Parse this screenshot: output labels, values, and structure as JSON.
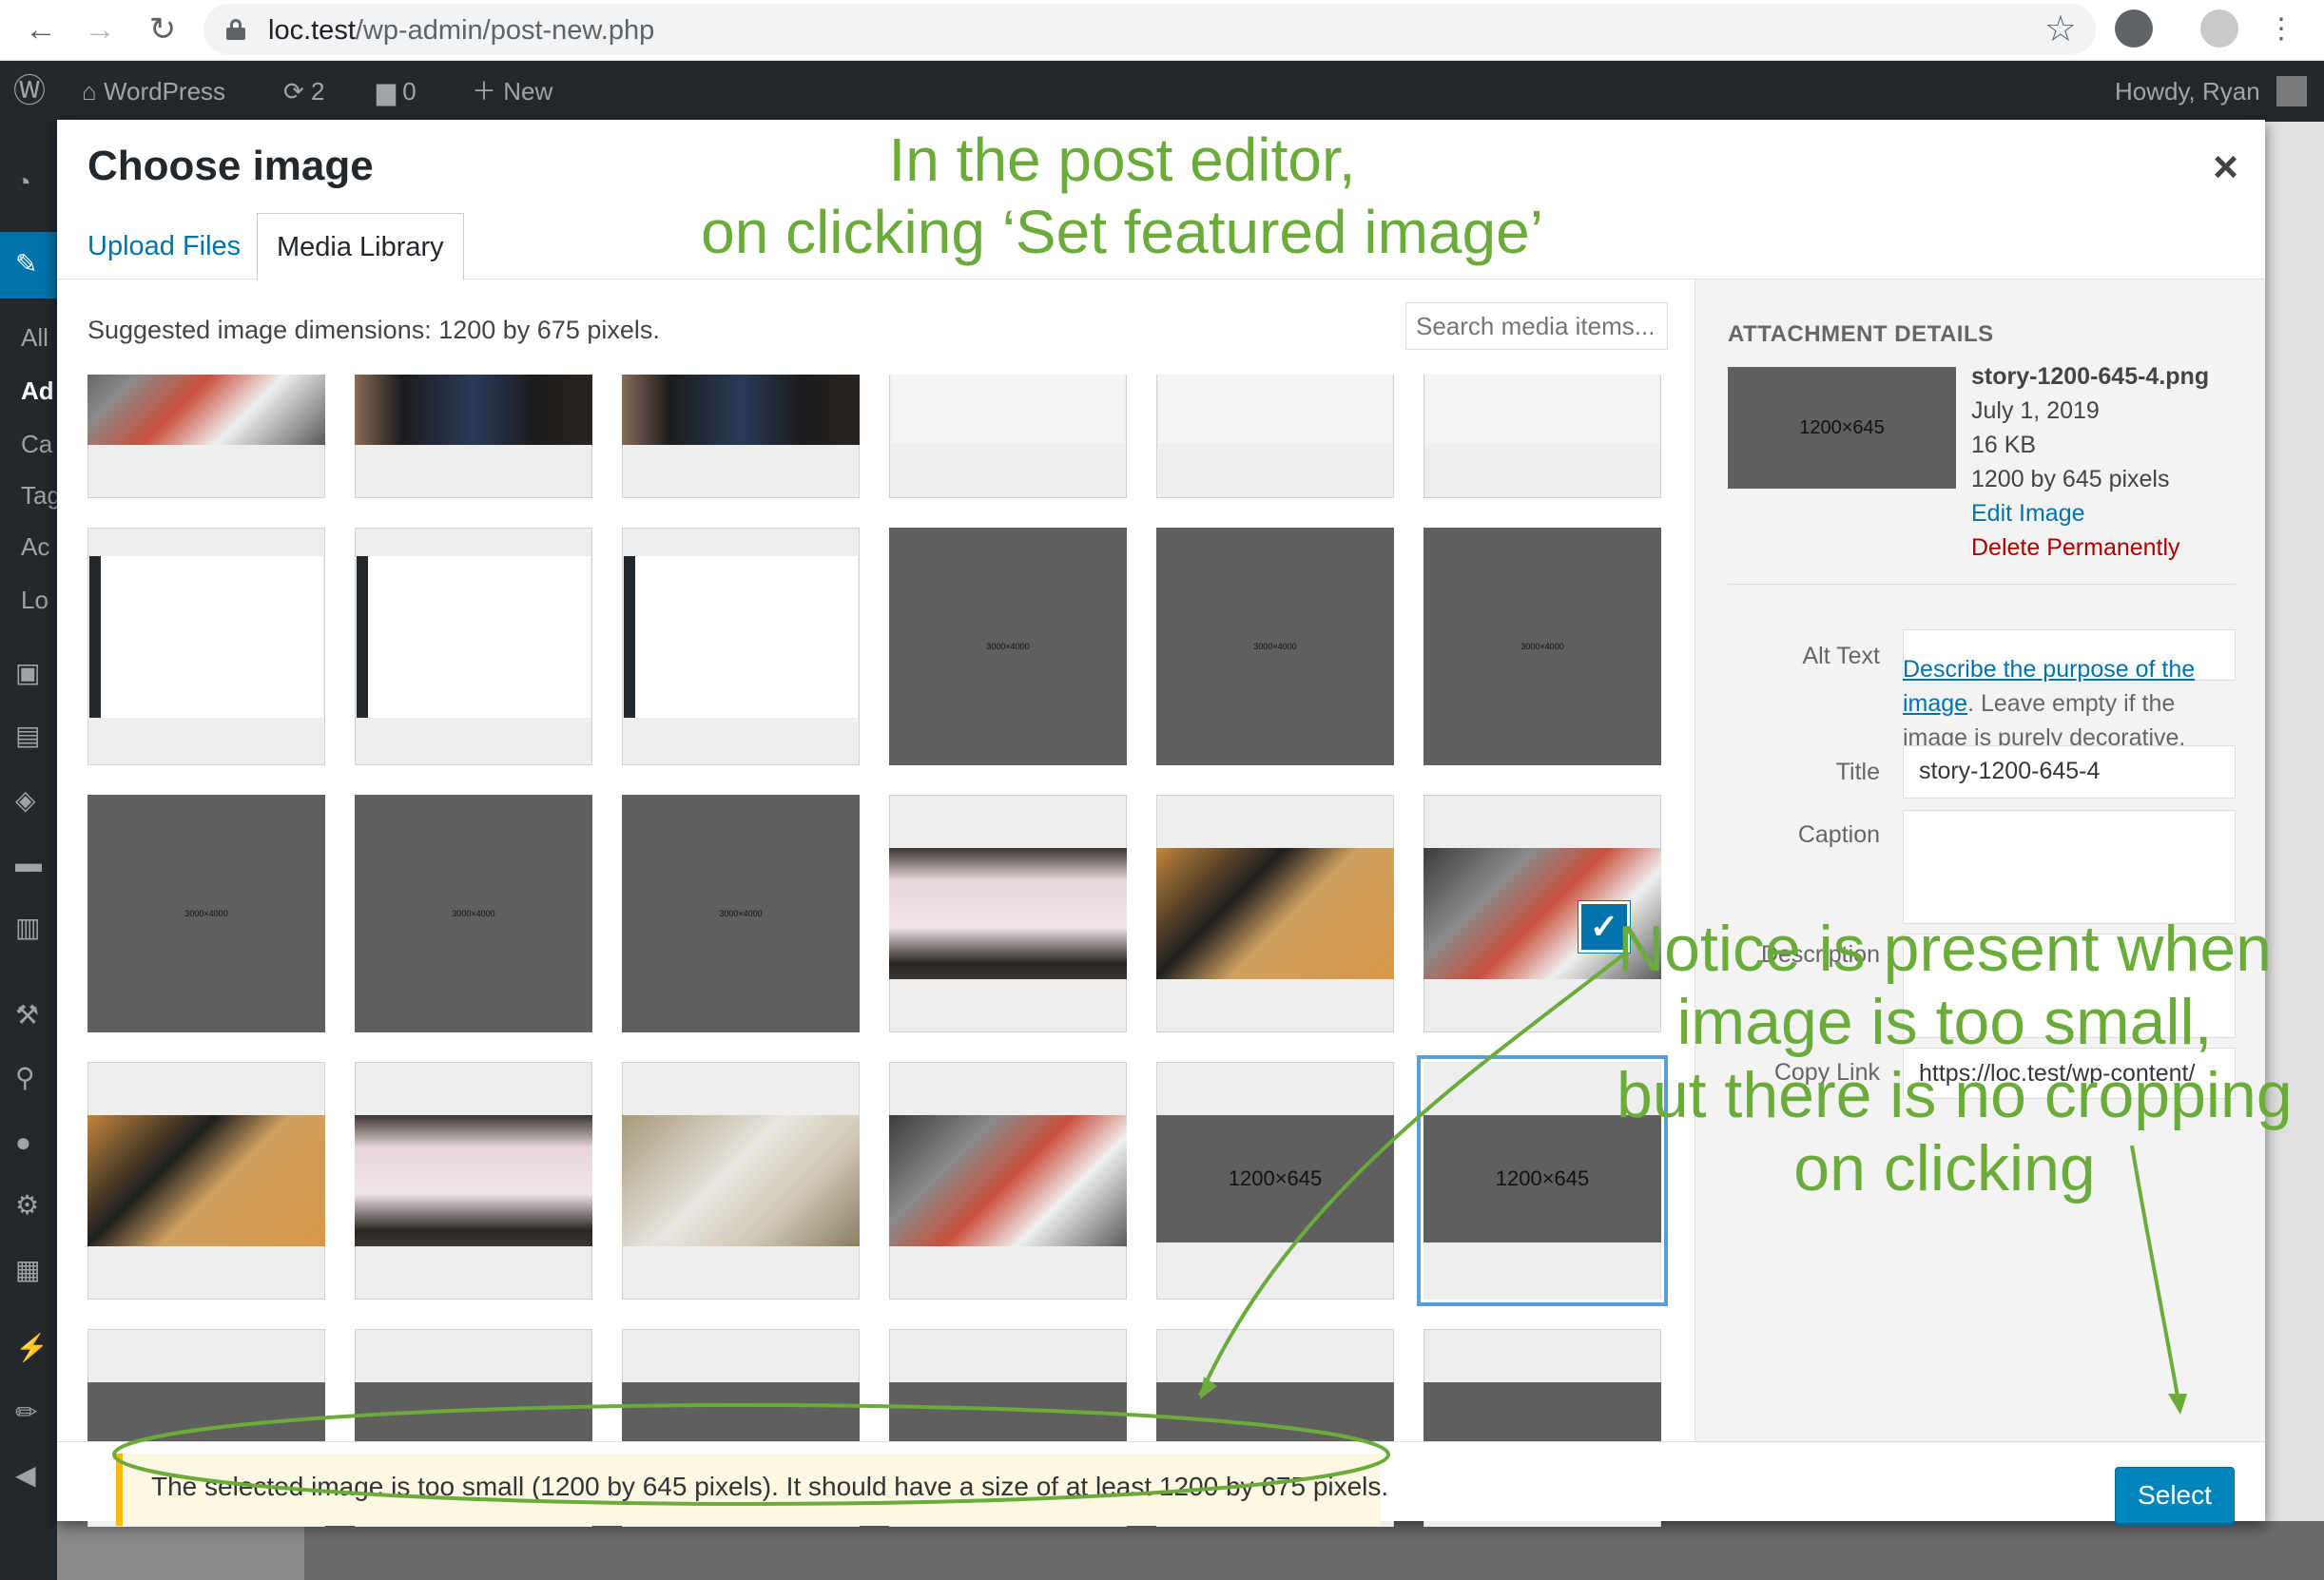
{
  "browser": {
    "url_host": "loc.test",
    "url_path": "/wp-admin/post-new.php"
  },
  "admin_bar": {
    "site_name": "WordPress",
    "updates_count": "2",
    "comments_count": "0",
    "new_label": "New",
    "greeting": "Howdy, Ryan"
  },
  "admin_sidebar": {
    "labels": [
      "All",
      "Ad",
      "Ca",
      "Tag",
      "Ac",
      "Lo"
    ]
  },
  "modal": {
    "title": "Choose image",
    "close_glyph": "×",
    "tabs": [
      {
        "label": "Upload Files",
        "active": false
      },
      {
        "label": "Media Library",
        "active": true
      }
    ],
    "suggested_dimensions": "Suggested image dimensions: 1200 by 675 pixels.",
    "search_placeholder": "Search media items...",
    "thumbnails": [
      {
        "kind": "photo-turntable",
        "label": ""
      },
      {
        "kind": "photo-tablet",
        "label": ""
      },
      {
        "kind": "photo-tablet",
        "label": ""
      },
      {
        "kind": "screenshot",
        "label": ""
      },
      {
        "kind": "screenshot",
        "label": ""
      },
      {
        "kind": "screenshot",
        "label": ""
      },
      {
        "kind": "screenshot",
        "label": ""
      },
      {
        "kind": "screenshot",
        "label": ""
      },
      {
        "kind": "screenshot",
        "label": ""
      },
      {
        "kind": "placeholder-full",
        "label": "3000×4000"
      },
      {
        "kind": "placeholder-full",
        "label": "3000×4000"
      },
      {
        "kind": "placeholder-full",
        "label": "3000×4000"
      },
      {
        "kind": "placeholder-full",
        "label": "3000×4000"
      },
      {
        "kind": "placeholder-full",
        "label": "3000×4000"
      },
      {
        "kind": "placeholder-full",
        "label": "3000×4000"
      },
      {
        "kind": "photo-laptop",
        "label": ""
      },
      {
        "kind": "photo-phone",
        "label": ""
      },
      {
        "kind": "photo-turntable",
        "label": ""
      },
      {
        "kind": "photo-phone",
        "label": ""
      },
      {
        "kind": "photo-laptop",
        "label": ""
      },
      {
        "kind": "photo-earbuds",
        "label": ""
      },
      {
        "kind": "photo-turntable",
        "label": ""
      },
      {
        "kind": "placeholder-mid",
        "label": "1200×645"
      },
      {
        "kind": "placeholder-mid",
        "label": "1200×645",
        "selected": true
      },
      {
        "kind": "partial",
        "label": ""
      },
      {
        "kind": "partial",
        "label": ""
      },
      {
        "kind": "partial",
        "label": ""
      },
      {
        "kind": "partial",
        "label": ""
      },
      {
        "kind": "partial",
        "label": ""
      },
      {
        "kind": "partial",
        "label": ""
      }
    ],
    "attachment_details": {
      "heading": "ATTACHMENT DETAILS",
      "thumb_label": "1200×645",
      "filename": "story-1200-645-4.png",
      "date": "July 1, 2019",
      "filesize": "16 KB",
      "dimensions": "1200 by 645 pixels",
      "edit_link": "Edit Image",
      "delete_link": "Delete Permanently",
      "alt_text_label": "Alt Text",
      "alt_text_value": "",
      "alt_help_link": "Describe the purpose of the image",
      "alt_help_rest": ". Leave empty if the image is purely decorative.",
      "title_label": "Title",
      "title_value": "story-1200-645-4",
      "caption_label": "Caption",
      "caption_value": "",
      "description_label": "Description",
      "description_value": "",
      "copy_link_label": "Copy Link",
      "copy_link_value": "https://loc.test/wp-content/"
    },
    "notice": "The selected image is too small (1200 by 645 pixels). It should have a size of at least 1200 by 675 pixels.",
    "select_button": "Select"
  },
  "annotations": {
    "top_line1": "In the post editor,",
    "top_line2": "on clicking ‘Set featured image’",
    "side_line1": "Notice is present when",
    "side_line2": "image is too small,",
    "side_line3": "but there is no cropping",
    "side_line4": "on clicking",
    "color": "#6aab3a"
  },
  "colors": {
    "wp_blue": "#0073aa",
    "button_blue": "#0085ba",
    "delete_red": "#a00",
    "notice_yellow": "#ffb900"
  }
}
